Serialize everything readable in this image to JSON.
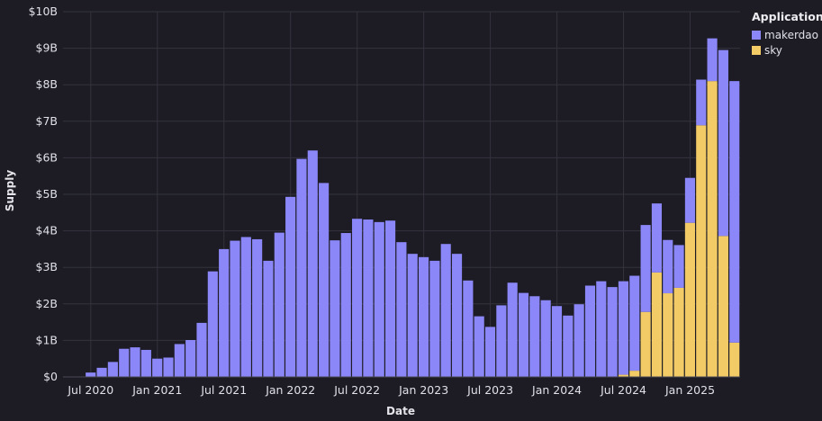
{
  "chart_data": {
    "type": "bar",
    "stacked": true,
    "xlabel": "Date",
    "ylabel": "Supply",
    "ylim": [
      0,
      10000000000
    ],
    "y_ticks": [
      "$0",
      "$1B",
      "$2B",
      "$3B",
      "$4B",
      "$5B",
      "$6B",
      "$7B",
      "$8B",
      "$9B",
      "$10B"
    ],
    "x_ticks": [
      {
        "month": "2020-07",
        "label": "Jul 2020"
      },
      {
        "month": "2021-01",
        "label": "Jan 2021"
      },
      {
        "month": "2021-07",
        "label": "Jul 2021"
      },
      {
        "month": "2022-01",
        "label": "Jan 2022"
      },
      {
        "month": "2022-07",
        "label": "Jul 2022"
      },
      {
        "month": "2023-01",
        "label": "Jan 2023"
      },
      {
        "month": "2023-07",
        "label": "Jul 2023"
      },
      {
        "month": "2024-01",
        "label": "Jan 2024"
      },
      {
        "month": "2024-07",
        "label": "Jul 2024"
      },
      {
        "month": "2025-01",
        "label": "Jan 2025"
      }
    ],
    "grid": true,
    "legend": {
      "title": "Application",
      "placement": "top-right"
    },
    "categories": [
      "2020-05",
      "2020-06",
      "2020-07",
      "2020-08",
      "2020-09",
      "2020-10",
      "2020-11",
      "2020-12",
      "2021-01",
      "2021-02",
      "2021-03",
      "2021-04",
      "2021-05",
      "2021-06",
      "2021-07",
      "2021-08",
      "2021-09",
      "2021-10",
      "2021-11",
      "2021-12",
      "2022-01",
      "2022-02",
      "2022-03",
      "2022-04",
      "2022-05",
      "2022-06",
      "2022-07",
      "2022-08",
      "2022-09",
      "2022-10",
      "2022-11",
      "2022-12",
      "2023-01",
      "2023-02",
      "2023-03",
      "2023-04",
      "2023-05",
      "2023-06",
      "2023-07",
      "2023-08",
      "2023-09",
      "2023-10",
      "2023-11",
      "2023-12",
      "2024-01",
      "2024-02",
      "2024-03",
      "2024-04",
      "2024-05",
      "2024-06",
      "2024-07",
      "2024-08",
      "2024-09",
      "2024-10",
      "2024-11",
      "2024-12",
      "2025-01",
      "2025-02",
      "2025-03",
      "2025-04",
      "2025-05"
    ],
    "series": [
      {
        "name": "makerdao",
        "color": "#8b87f8",
        "unit": "billion USD",
        "values": [
          0.01,
          0.01,
          0.12,
          0.25,
          0.41,
          0.77,
          0.81,
          0.74,
          0.5,
          0.53,
          0.9,
          1.01,
          1.48,
          2.89,
          3.5,
          3.73,
          3.83,
          3.77,
          3.18,
          3.95,
          4.93,
          5.97,
          6.2,
          5.31,
          3.74,
          3.94,
          4.33,
          4.31,
          4.24,
          4.28,
          3.69,
          3.37,
          3.28,
          3.18,
          3.64,
          3.37,
          2.64,
          1.66,
          1.37,
          1.96,
          2.58,
          2.3,
          2.21,
          2.1,
          1.94,
          1.68,
          1.99,
          2.5,
          2.62,
          2.46,
          2.56,
          2.6,
          2.38,
          1.89,
          1.46,
          1.17,
          1.23,
          1.25,
          1.17,
          5.09,
          7.16
        ]
      },
      {
        "name": "sky",
        "color": "#f2cb66",
        "unit": "billion USD",
        "values": [
          0,
          0,
          0,
          0,
          0,
          0,
          0,
          0,
          0,
          0,
          0,
          0,
          0,
          0,
          0,
          0,
          0,
          0,
          0,
          0,
          0,
          0,
          0,
          0,
          0,
          0,
          0,
          0,
          0,
          0,
          0,
          0,
          0,
          0,
          0,
          0,
          0,
          0,
          0,
          0,
          0,
          0,
          0,
          0,
          0,
          0,
          0,
          0,
          0,
          0,
          0.06,
          0.17,
          1.78,
          2.86,
          2.29,
          2.44,
          4.22,
          6.89,
          8.1,
          3.86,
          0.94
        ]
      }
    ]
  }
}
